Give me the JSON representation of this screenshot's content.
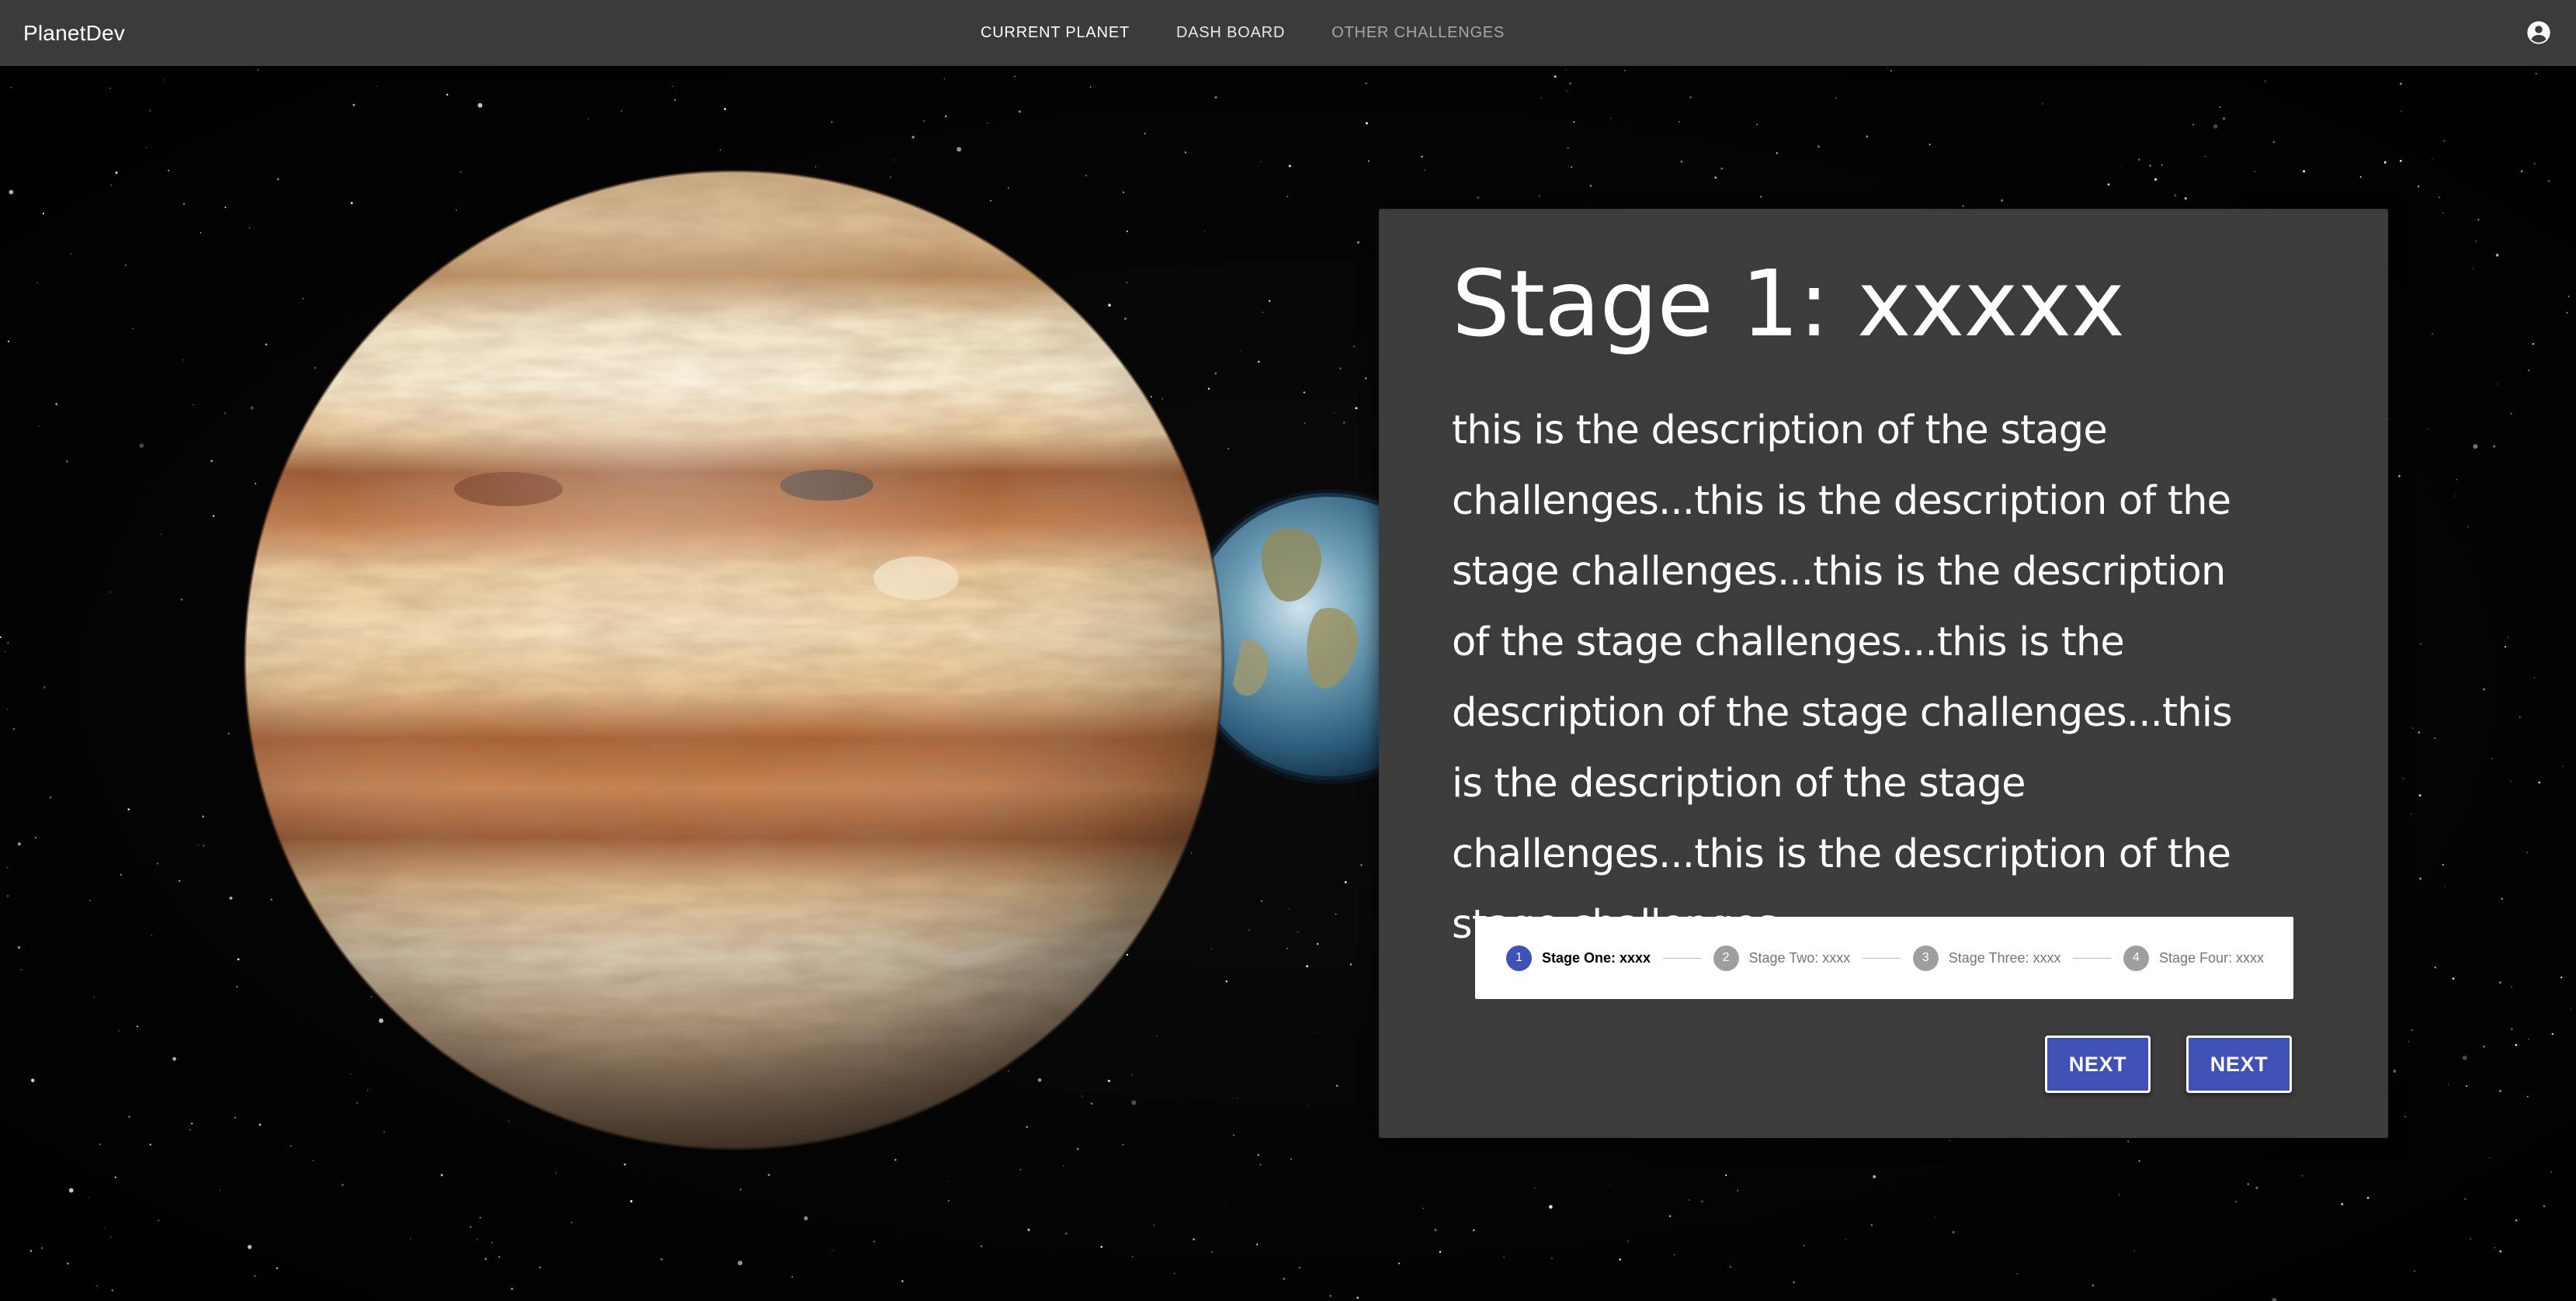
{
  "app": {
    "brand": "PlanetDev"
  },
  "nav": {
    "items": [
      {
        "label": "CURRENT PLANET"
      },
      {
        "label": "DASH BOARD"
      },
      {
        "label": "OTHER CHALLENGES"
      }
    ]
  },
  "icons": {
    "account": "account-circle-icon"
  },
  "stage": {
    "title": "Stage 1: xxxxx",
    "description": "this is the description of the stage challenges...this is the description of the stage challenges...this is the description of the stage challenges...this is the description of the stage challenges...this is the description of the stage challenges...this is the description of the stage challenges...",
    "steps": [
      {
        "number": "1",
        "label": "Stage One: xxxx",
        "active": true
      },
      {
        "number": "2",
        "label": "Stage Two: xxxx",
        "active": false
      },
      {
        "number": "3",
        "label": "Stage Three: xxxx",
        "active": false
      },
      {
        "number": "4",
        "label": "Stage Four: xxxx",
        "active": false
      }
    ],
    "buttons": [
      {
        "label": "NEXT"
      },
      {
        "label": "NEXT"
      }
    ]
  },
  "colors": {
    "topbar": "#3b3b3b",
    "card": "#3c3c3c",
    "accent": "#3f51b5",
    "inactive_step": "#9e9e9e"
  }
}
